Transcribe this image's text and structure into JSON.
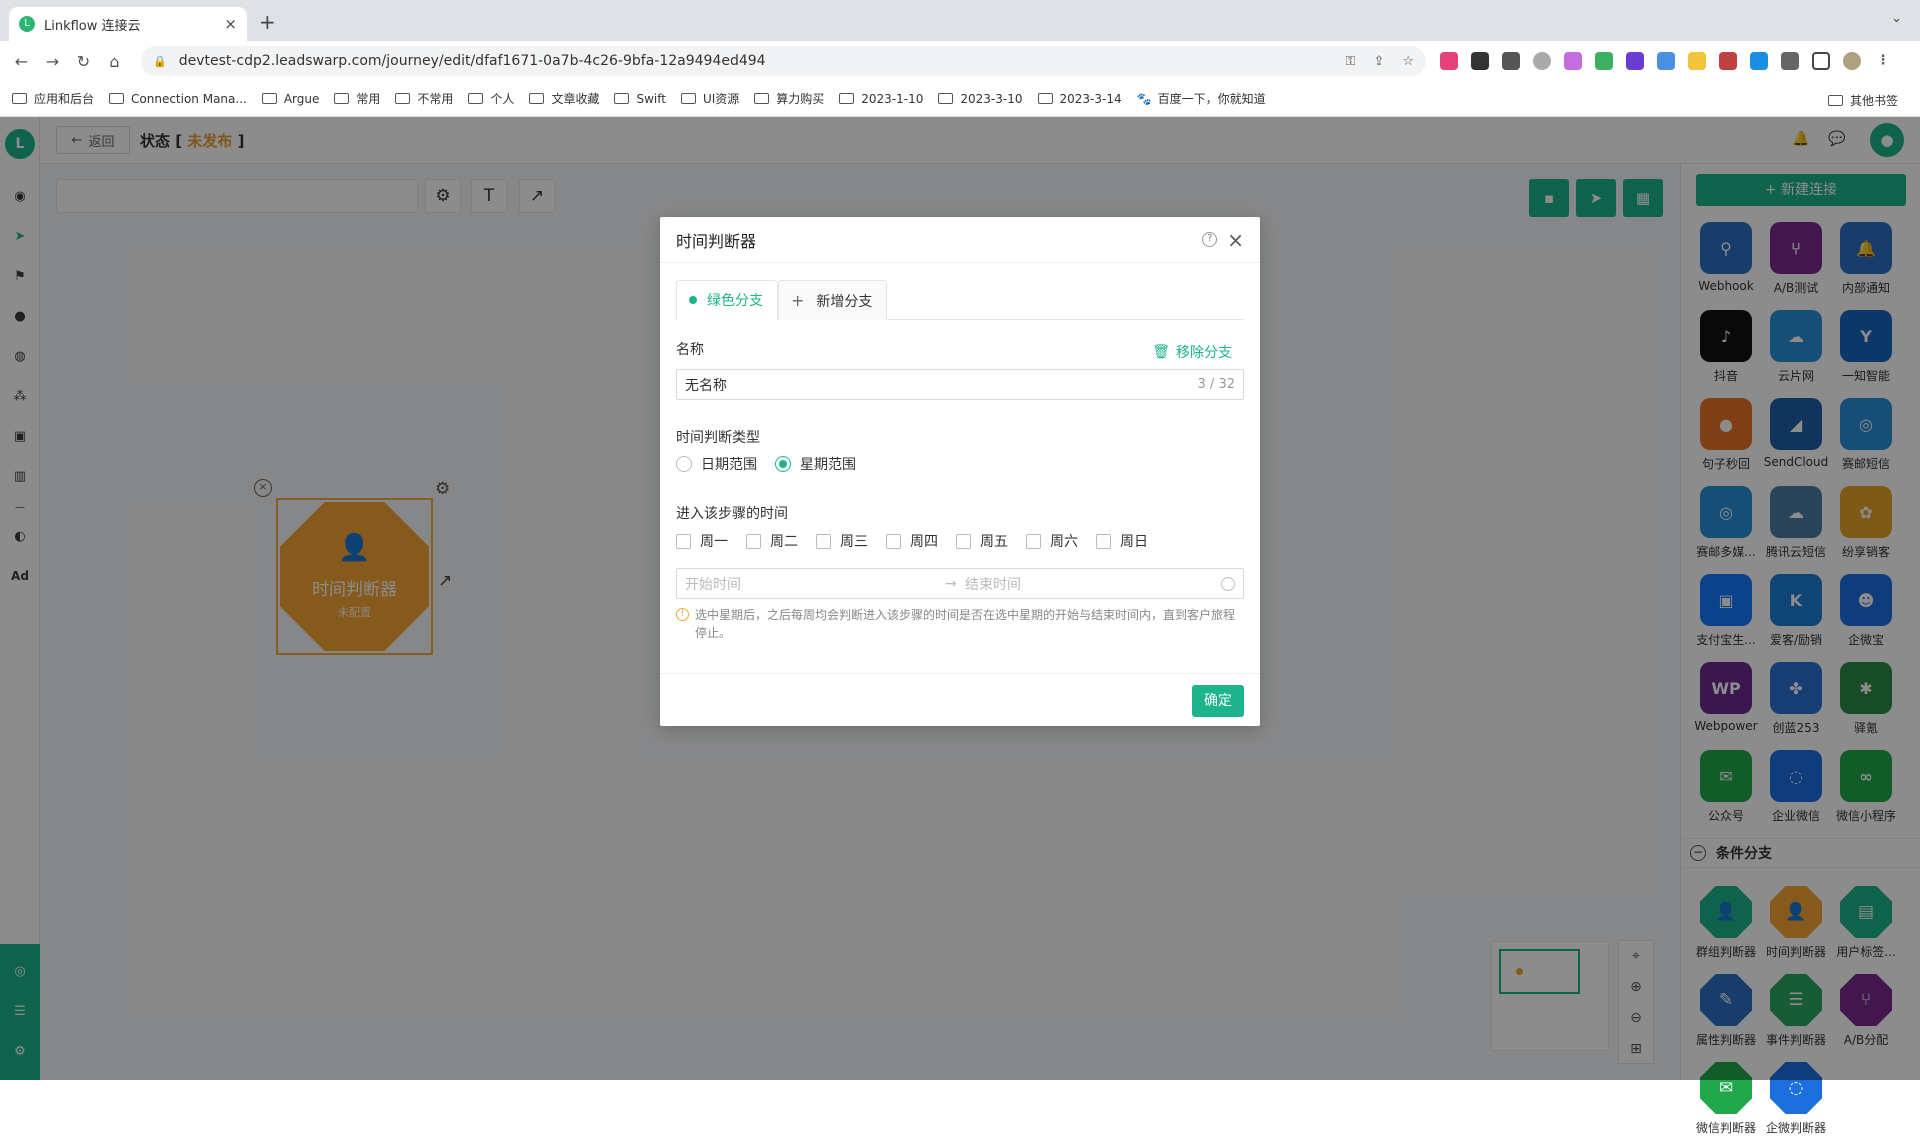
{
  "browser": {
    "tab_title": "Linkflow 连接云",
    "tab_close": "×",
    "new_tab": "+",
    "url": "devtest-cdp2.leadswarp.com/journey/edit/dfaf1671-0a7b-4c26-9bfa-12a9494ed494",
    "bookmarks": [
      "应用和后台",
      "Connection Mana...",
      "Argue",
      "常用",
      "不常用",
      "个人",
      "文章收藏",
      "Swift",
      "UI资源",
      "算力购买",
      "2023-1-10",
      "2023-3-10",
      "2023-3-14",
      "百度一下，你就知道"
    ],
    "other_bookmarks": "其他书签"
  },
  "header": {
    "back_label": "返回",
    "status_prefix": "状态",
    "status_value": "未发布"
  },
  "canvas": {
    "node_title": "时间判断器",
    "node_subtitle": "未配置"
  },
  "right_panel": {
    "new_connection": "新建连接",
    "connectors": [
      {
        "label": "Webhook",
        "color": "#2d6fc4",
        "icon": "webhook-icon"
      },
      {
        "label": "A/B测试",
        "color": "#7a2a8c",
        "icon": "ab-test-icon"
      },
      {
        "label": "内部通知",
        "color": "#2d6fc4",
        "icon": "bell-icon"
      },
      {
        "label": "抖音",
        "color": "#111111",
        "icon": "tiktok-icon"
      },
      {
        "label": "云片网",
        "color": "#2b8fd6",
        "icon": "cloud-icon"
      },
      {
        "label": "一知智能",
        "color": "#1565c0",
        "icon": "yiwise-icon"
      },
      {
        "label": "句子秒回",
        "color": "#e8762a",
        "icon": "chat-icon"
      },
      {
        "label": "SendCloud",
        "color": "#1f5fa8",
        "icon": "sendcloud-icon"
      },
      {
        "label": "赛邮短信",
        "color": "#2b8fd6",
        "icon": "sms-icon"
      },
      {
        "label": "赛邮多媒...",
        "color": "#2b8fd6",
        "icon": "mms-icon"
      },
      {
        "label": "腾讯云短信",
        "color": "#4a7ea8",
        "icon": "tencent-cloud-icon"
      },
      {
        "label": "纷享销客",
        "color": "#e8a22a",
        "icon": "fxiaoke-icon"
      },
      {
        "label": "支付宝生...",
        "color": "#1677ff",
        "icon": "alipay-icon"
      },
      {
        "label": "爱客/励销",
        "color": "#1d7fd6",
        "icon": "k-icon"
      },
      {
        "label": "企微宝",
        "color": "#1d6fe0",
        "icon": "qiweibao-icon"
      },
      {
        "label": "Webpower",
        "color": "#6b2a8c",
        "icon": "webpower-icon"
      },
      {
        "label": "创蓝253",
        "color": "#2b6fd6",
        "icon": "chuanglan-icon"
      },
      {
        "label": "驿氪",
        "color": "#2a8a4a",
        "icon": "spider-icon"
      },
      {
        "label": "公众号",
        "color": "#20a84a",
        "icon": "wechat-icon"
      },
      {
        "label": "企业微信",
        "color": "#1d6fe0",
        "icon": "wecom-icon"
      },
      {
        "label": "微信小程序",
        "color": "#20a84a",
        "icon": "miniprogram-icon"
      }
    ],
    "section_title": "条件分支",
    "conditions": [
      {
        "label": "群组判断器",
        "color": "#1db48b",
        "icon": "group-icon"
      },
      {
        "label": "时间判断器",
        "color": "#f2a534",
        "icon": "time-icon"
      },
      {
        "label": "用户标签...",
        "color": "#1db48b",
        "icon": "tag-icon"
      },
      {
        "label": "属性判断器",
        "color": "#2d6fc4",
        "icon": "edit-icon"
      },
      {
        "label": "事件判断器",
        "color": "#2aa860",
        "icon": "list-icon"
      },
      {
        "label": "A/B分配",
        "color": "#7a2a8c",
        "icon": "ab-split-icon"
      },
      {
        "label": "微信判断器",
        "color": "#20a84a",
        "icon": "wechat-icon"
      },
      {
        "label": "企微判断器",
        "color": "#1d6fe0",
        "icon": "wecom-icon"
      }
    ]
  },
  "modal": {
    "title": "时间判断器",
    "tab_active": "绿色分支",
    "tab_add": "新增分支",
    "name_label": "名称",
    "remove_label": "移除分支",
    "name_value": "无名称",
    "name_count": "3 / 32",
    "type_label": "时间判断类型",
    "type_options": [
      "日期范围",
      "星期范围"
    ],
    "type_selected": "星期范围",
    "time_label": "进入该步骤的时间",
    "weekdays": [
      "周一",
      "周二",
      "周三",
      "周四",
      "周五",
      "周六",
      "周日"
    ],
    "start_placeholder": "开始时间",
    "end_placeholder": "结束时间",
    "tip": "选中星期后，之后每周均会判断进入该步骤的时间是否在选中星期的开始与结束时间内，直到客户旅程停止。",
    "ok_label": "确定"
  }
}
